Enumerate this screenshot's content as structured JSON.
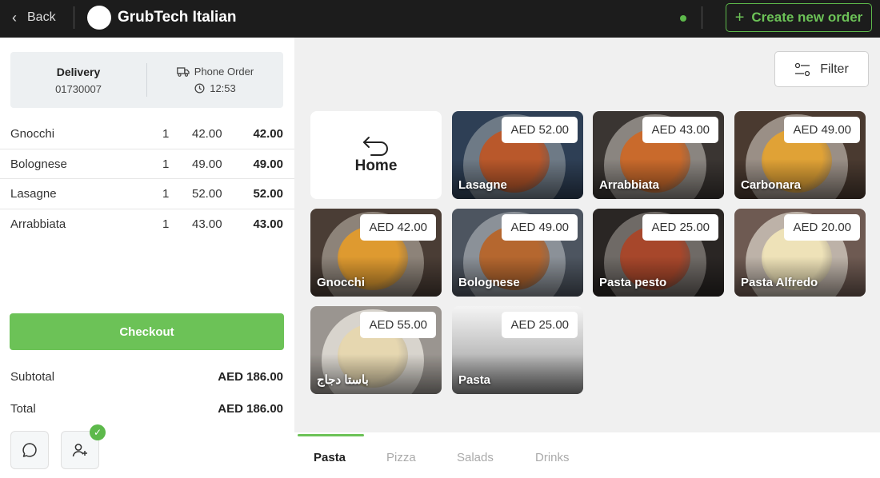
{
  "header": {
    "back_label": "Back",
    "brand_name": "GrubTech Italian",
    "create_label": "Create new order",
    "accent_color": "#6cc257"
  },
  "order_info": {
    "type_title": "Delivery",
    "order_number": "01730007",
    "channel": "Phone Order",
    "time": "12:53"
  },
  "order_items": [
    {
      "name": "Gnocchi",
      "qty": "1",
      "price": "42.00",
      "total": "42.00"
    },
    {
      "name": "Bolognese",
      "qty": "1",
      "price": "49.00",
      "total": "49.00"
    },
    {
      "name": "Lasagne",
      "qty": "1",
      "price": "52.00",
      "total": "52.00"
    },
    {
      "name": "Arrabbiata",
      "qty": "1",
      "price": "43.00",
      "total": "43.00"
    }
  ],
  "checkout_label": "Checkout",
  "summary": {
    "subtotal_label": "Subtotal",
    "subtotal_value": "AED 186.00",
    "total_label": "Total",
    "total_value": "AED 186.00"
  },
  "filter_label": "Filter",
  "home_label": "Home",
  "menu_items": [
    {
      "name": "Lasagne",
      "price": "AED 52.00",
      "bg": "#2e3f55",
      "plate": "#6e7a86",
      "food": "#b9582b"
    },
    {
      "name": "Arrabbiata",
      "price": "AED 43.00",
      "bg": "#3a3532",
      "plate": "#8a8580",
      "food": "#c96a2c"
    },
    {
      "name": "Carbonara",
      "price": "AED 49.00",
      "bg": "#4a3a30",
      "plate": "#9a8f86",
      "food": "#e0a236"
    },
    {
      "name": "Gnocchi",
      "price": "AED 42.00",
      "bg": "#4a3d35",
      "plate": "#8d8379",
      "food": "#de9a30"
    },
    {
      "name": "Bolognese",
      "price": "AED 49.00",
      "bg": "#4d5560",
      "plate": "#8b9198",
      "food": "#b5672f"
    },
    {
      "name": "Pasta pesto",
      "price": "AED 25.00",
      "bg": "#2a2624",
      "plate": "#6f6a66",
      "food": "#a7472b"
    },
    {
      "name": "Pasta Alfredo",
      "price": "AED 20.00",
      "bg": "#6e5a52",
      "plate": "#bdb2a8",
      "food": "#eee2b8"
    },
    {
      "name": "باستا دجاج",
      "price": "AED 55.00",
      "bg": "#9a9590",
      "plate": "#d8d4cd",
      "food": "#e6d7b0"
    },
    {
      "name": "Pasta",
      "price": "AED 25.00",
      "bg": "#8f8f8f",
      "plate": "",
      "food": ""
    }
  ],
  "tabs": [
    {
      "label": "Pasta",
      "active": true
    },
    {
      "label": "Pizza",
      "active": false
    },
    {
      "label": "Salads",
      "active": false
    },
    {
      "label": "Drinks",
      "active": false
    }
  ]
}
